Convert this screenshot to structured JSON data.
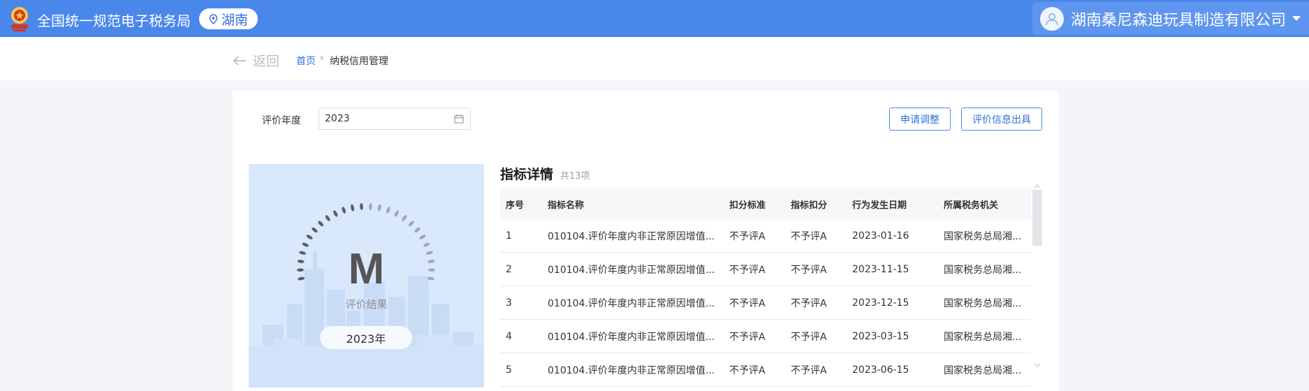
{
  "header": {
    "site_title": "全国统一规范电子税务局",
    "region": "湖南",
    "company_name": "湖南桑尼森迪玩具制造有限公司",
    "brand_color": "#4a87ea"
  },
  "breadcrumb": {
    "back_label": "返回",
    "home_label": "首页",
    "separator": "›",
    "current": "纳税信用管理"
  },
  "filter": {
    "year_label": "评价年度",
    "year_value": "2023"
  },
  "actions": {
    "adjust_label": "申请调整",
    "issue_label": "评价信息出具"
  },
  "result": {
    "grade": "M",
    "grade_caption": "评价结果",
    "year_label": "2023年"
  },
  "detail": {
    "title": "指标详情",
    "count_label": "共13项",
    "columns": [
      "序号",
      "指标名称",
      "扣分标准",
      "指标扣分",
      "行为发生日期",
      "所属税务机关"
    ],
    "rows": [
      [
        "1",
        "010104.评价年度内非正常原因增值...",
        "不予评A",
        "不予评A",
        "2023-01-16",
        "国家税务总局湘..."
      ],
      [
        "2",
        "010104.评价年度内非正常原因增值...",
        "不予评A",
        "不予评A",
        "2023-11-15",
        "国家税务总局湘..."
      ],
      [
        "3",
        "010104.评价年度内非正常原因增值...",
        "不予评A",
        "不予评A",
        "2023-12-15",
        "国家税务总局湘..."
      ],
      [
        "4",
        "010104.评价年度内非正常原因增值...",
        "不予评A",
        "不予评A",
        "2023-03-15",
        "国家税务总局湘..."
      ],
      [
        "5",
        "010104.评价年度内非正常原因增值...",
        "不予评A",
        "不予评A",
        "2023-06-15",
        "国家税务总局湘..."
      ]
    ]
  }
}
